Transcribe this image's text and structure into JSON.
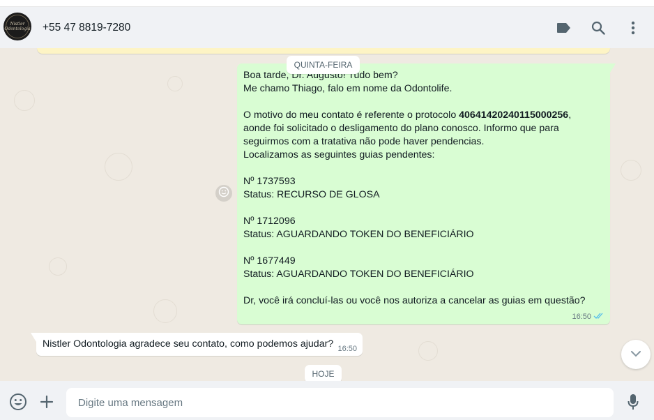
{
  "header": {
    "avatar_logo_text": "Nistler Odontologia",
    "contact_name": "+55 47 8819-7280",
    "icons": [
      "label-icon",
      "search-icon",
      "menu-icon"
    ]
  },
  "chat": {
    "day_separator_1": "QUINTA-FEIRA",
    "outgoing": {
      "lines_before_bold": "Boa tarde, Dr. Augusto! Tudo bem?\nMe chamo Thiago, falo em nome da Odontolife.\n\nO motivo do meu contato é referente o protocolo ",
      "protocol": "40641420240115000256",
      "lines_after_bold": ",\naonde foi solicitado o desligamento do plano conosco. Informo que para\nseguirmos com a tratativa não pode haver pendencias.\nLocalizamos as seguintes guias pendentes:\n\nNº 1737593\nStatus: RECURSO DE GLOSA\n\nNº 1712096\nStatus: AGUARDANDO TOKEN DO BENEFICIÁRIO\n\nNº 1677449\nStatus: AGUARDANDO TOKEN DO BENEFICIÁRIO\n\nDr, você irá concluí-las ou você nos autoriza a cancelar as guias em questão?",
      "time": "16:50",
      "status": "read"
    },
    "incoming": {
      "text": "Nistler Odontologia agradece seu contato, como podemos ajudar?",
      "time": "16:50"
    },
    "day_separator_2": "HOJE"
  },
  "footer": {
    "placeholder": "Digite uma mensagem",
    "value": ""
  },
  "colors": {
    "outgoing_bubble": "#d9fdd3",
    "chat_bg": "#efeae2",
    "read_ticks": "#53bdeb"
  }
}
